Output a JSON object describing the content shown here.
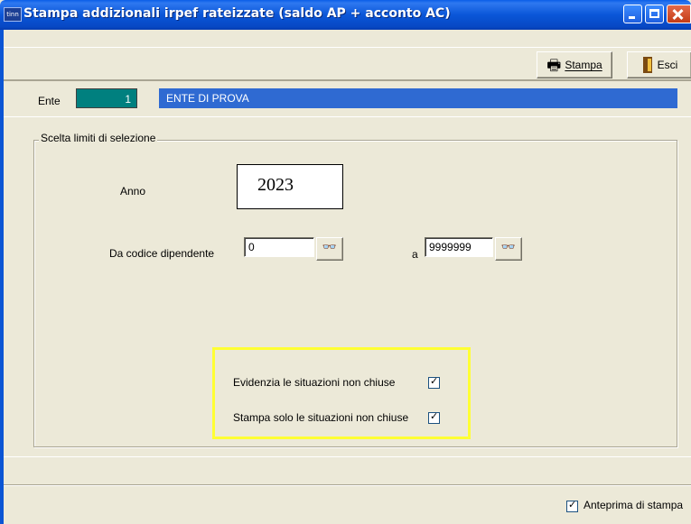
{
  "window": {
    "title": "Stampa addizionali irpef rateizzate (saldo AP + acconto AC)",
    "icon_text": "tinn"
  },
  "toolbar": {
    "print_label": "Stampa",
    "exit_label": "Esci"
  },
  "ente": {
    "label": "Ente",
    "code": "1",
    "name": "ENTE DI PROVA"
  },
  "selection": {
    "group_title": "Scelta limiti di selezione",
    "anno_label": "Anno",
    "anno_value": "2023",
    "codice_label": "Da codice dipendente",
    "codice_from": "0",
    "codice_to_label": "a",
    "codice_to": "9999999",
    "lookup_icon": "glasses-icon"
  },
  "options": {
    "evidenzia_label": "Evidenzia le situazioni non chiuse",
    "evidenzia_checked": true,
    "solo_non_chiuse_label": "Stampa solo le situazioni non chiuse",
    "solo_non_chiuse_checked": true
  },
  "footer": {
    "preview_label": "Anteprima di stampa",
    "preview_checked": true
  },
  "colors": {
    "titlebar": "#0a56d8",
    "ente_code_bg": "#00807f",
    "ente_name_bg": "#2f6ad2",
    "highlight": "#ffff33"
  }
}
